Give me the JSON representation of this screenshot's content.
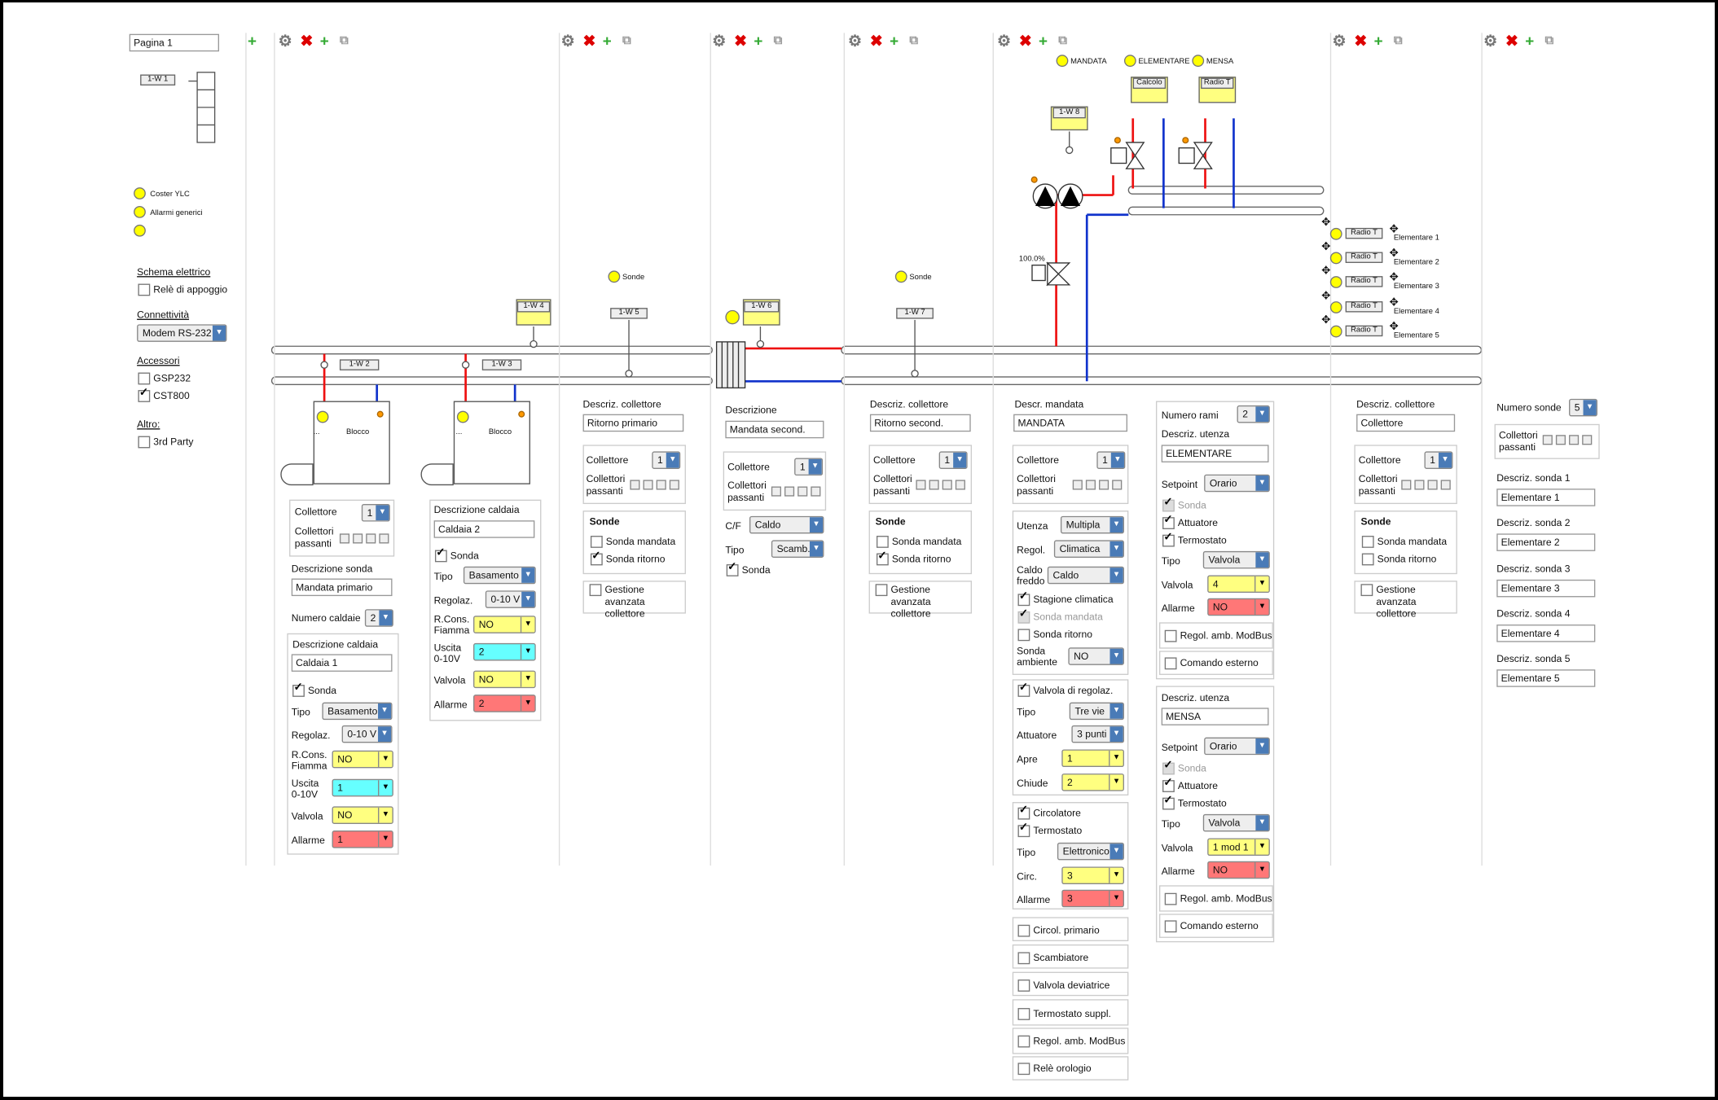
{
  "page": {
    "title": "Pagina 1"
  },
  "legend": {
    "coster": "Coster YLC",
    "allarmi": "Allarmi generici"
  },
  "sidebar": {
    "schema_label": "Schema elettrico",
    "rele": "Relè di appoggio",
    "conn_label": "Connettività",
    "modem": "Modem RS-232",
    "accessori_label": "Accessori",
    "gsp": "GSP232",
    "cst": "CST800",
    "altro_label": "Altro:",
    "third": "3rd Party"
  },
  "w": {
    "w1": "1-W 1",
    "w2": "1-W 2",
    "w3": "1-W 3",
    "w4": "1-W 4",
    "w5": "1-W 5",
    "w6": "1-W 6",
    "w7": "1-W 7",
    "w8": "1-W 8"
  },
  "common": {
    "collettore": "Collettore",
    "coll_pass": "Collettori passanti",
    "uno": "1",
    "sonde": "Sonde",
    "sonda_mandata": "Sonda mandata",
    "sonda_ritorno": "Sonda ritorno",
    "gestione": "Gestione avanzata collettore",
    "descr_coll": "Descriz. collettore",
    "blocco": "Blocco",
    "dots": "...",
    "sonda": "Sonda",
    "tipo": "Tipo",
    "regolaz": "Regolaz.",
    "rcons": "R.Cons. Fiamma",
    "uscita": "Uscita 0-10V",
    "valvola": "Valvola",
    "allarme": "Allarme",
    "regol_modbus": "Regol. amb. ModBus",
    "comando": "Comando esterno",
    "setpoint": "Setpoint",
    "attuatore": "Attuatore",
    "termostato": "Termostato",
    "descr_utenza": "Descriz. utenza"
  },
  "boilers": {
    "descr_sonda": "Descrizione sonda",
    "sonda_val": "Mandata primario",
    "num_caldaie": "Numero caldaie",
    "num_val": "2",
    "descr_caldaia": "Descrizione caldaia",
    "b1": {
      "name": "Caldaia 1",
      "tipo": "Basamento",
      "reg": "0-10 V",
      "rcons": "NO",
      "uscita": "1",
      "valvola": "NO",
      "allarme": "1"
    },
    "b2": {
      "name": "Caldaia 2",
      "tipo": "Basamento",
      "reg": "0-10 V",
      "rcons": "NO",
      "uscita": "2",
      "valvola": "NO",
      "allarme": "2"
    }
  },
  "col3": {
    "sonde": "Sonde",
    "descr": "Ritorno primario"
  },
  "col4": {
    "descrizione": "Descrizione",
    "descr": "Mandata second.",
    "cf": "C/F",
    "cf_val": "Caldo",
    "tipo_val": "Scamb.",
    "sonda": "Sonda"
  },
  "col5": {
    "sonde": "Sonde",
    "descr": "Ritorno second."
  },
  "col6": {
    "leds": [
      "MANDATA",
      "ELEMENTARE",
      "MENSA"
    ],
    "calcolo": "Calcolo",
    "radio": "Radio T",
    "pct": "100.0%",
    "descr_mandata": "Descr. mandata",
    "mandata_val": "MANDATA",
    "utenza": "Utenza",
    "utenza_val": "Multipla",
    "regol": "Regol.",
    "regol_val": "Climatica",
    "caldo_freddo": "Caldo freddo",
    "cf_val": "Caldo",
    "stagione": "Stagione climatica",
    "sonda_mandata": "Sonda mandata",
    "sonda_ritorno": "Sonda ritorno",
    "sonda_amb": "Sonda ambiente",
    "sonda_amb_val": "NO",
    "valvola_reg": "Valvola di regolaz.",
    "tipo_val": "Tre vie",
    "attuatore": "Attuatore",
    "att_val": "3 punti",
    "apre": "Apre",
    "apre_val": "1",
    "chiude": "Chiude",
    "chiude_val": "2",
    "circolatore": "Circolatore",
    "termostato": "Termostato",
    "tipo2_val": "Elettronico",
    "circ": "Circ.",
    "circ_val": "3",
    "allarme_val": "3",
    "extras": [
      "Circol. primario",
      "Scambiatore",
      "Valvola deviatrice",
      "Termostato suppl.",
      "Regol. amb. ModBus",
      "Relè orologio"
    ]
  },
  "col7": {
    "num_rami": "Numero rami",
    "num_rami_val": "2",
    "u1": {
      "name": "ELEMENTARE",
      "setpoint": "Orario",
      "tipo": "Valvola",
      "valvola": "4",
      "allarme": "NO"
    },
    "u2": {
      "name": "MENSA",
      "setpoint": "Orario",
      "tipo": "Valvola",
      "valvola": "1 mod 1",
      "allarme": "NO"
    }
  },
  "col8": {
    "radio": "Radio T",
    "elementi": [
      "Elementare 1",
      "Elementare 2",
      "Elementare 3",
      "Elementare 4",
      "Elementare 5"
    ],
    "descr": "Collettore"
  },
  "col9": {
    "num_sonde": "Numero sonde",
    "num_val": "5",
    "labels": [
      "Descriz. sonda 1",
      "Descriz. sonda 2",
      "Descriz. sonda 3",
      "Descriz. sonda 4",
      "Descriz. sonda 5"
    ],
    "values": [
      "Elementare 1",
      "Elementare 2",
      "Elementare 3",
      "Elementare 4",
      "Elementare 5"
    ]
  },
  "colors": {
    "hot": "#ee1111",
    "cold": "#1133cc"
  }
}
